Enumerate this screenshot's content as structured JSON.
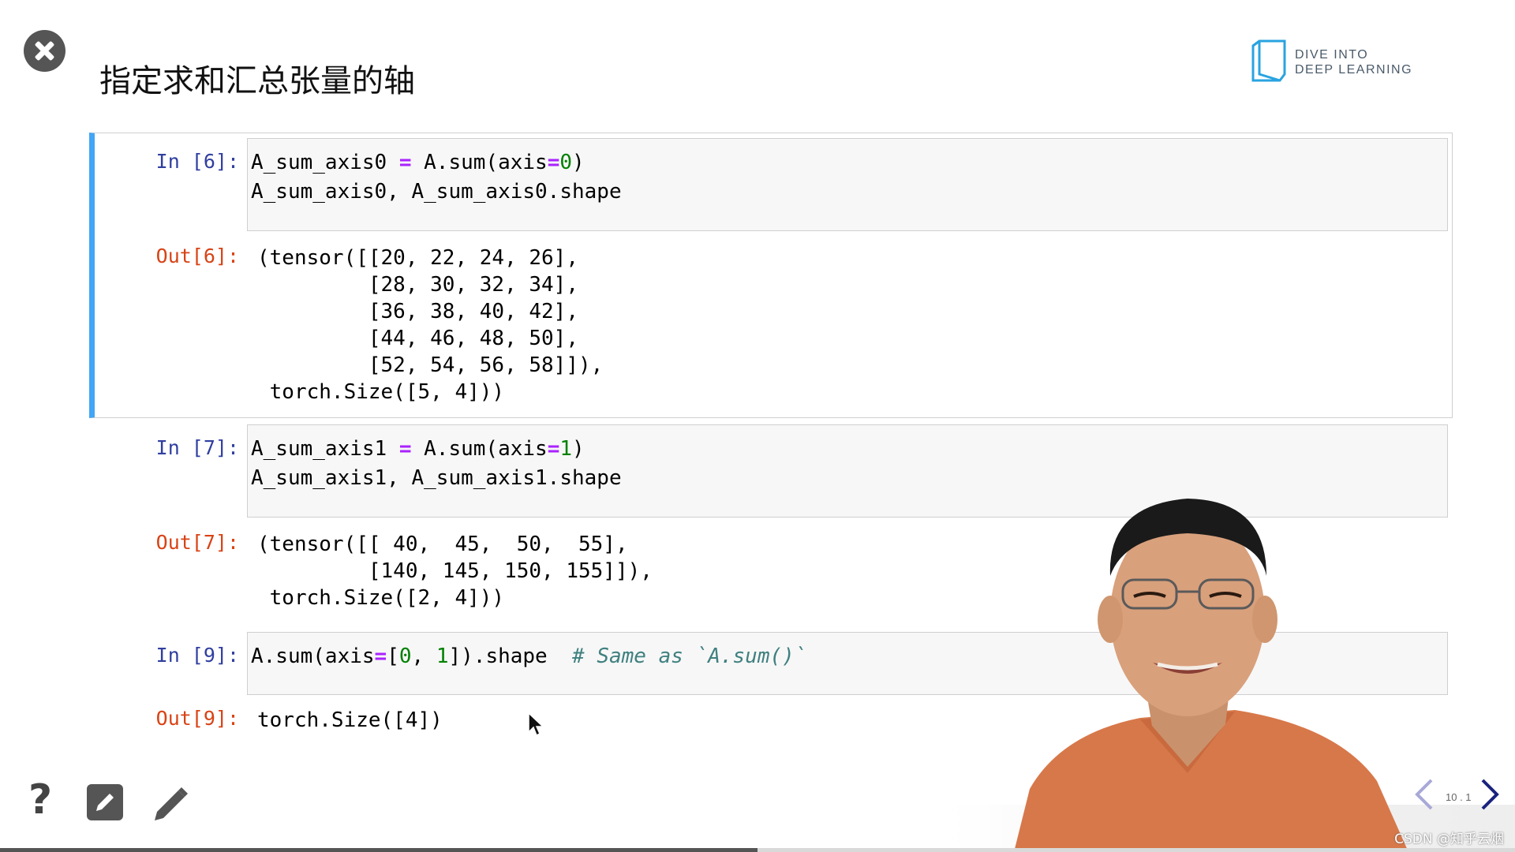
{
  "slide": {
    "title": "指定求和汇总张量的轴",
    "brand_line1": "DIVE INTO",
    "brand_line2": "DEEP LEARNING"
  },
  "cells": [
    {
      "in_prompt": "In [6]:",
      "code_line1_a": "A_sum_axis0 ",
      "code_line1_op": "=",
      "code_line1_b": " A.sum(axis",
      "code_line1_op2": "=",
      "code_line1_num": "0",
      "code_line1_c": ")",
      "code_line2": "A_sum_axis0, A_sum_axis0.shape",
      "out_prompt": "Out[6]:",
      "output": "(tensor([[20, 22, 24, 26],\n         [28, 30, 32, 34],\n         [36, 38, 40, 42],\n         [44, 46, 48, 50],\n         [52, 54, 56, 58]]),\n torch.Size([5, 4]))"
    },
    {
      "in_prompt": "In [7]:",
      "code_line1_a": "A_sum_axis1 ",
      "code_line1_op": "=",
      "code_line1_b": " A.sum(axis",
      "code_line1_op2": "=",
      "code_line1_num": "1",
      "code_line1_c": ")",
      "code_line2": "A_sum_axis1, A_sum_axis1.shape",
      "out_prompt": "Out[7]:",
      "output": "(tensor([[ 40,  45,  50,  55],\n         [140, 145, 150, 155]]),\n torch.Size([2, 4]))"
    },
    {
      "in_prompt": "In [9]:",
      "code_a": "A.sum(axis",
      "code_op": "=",
      "code_b": "[",
      "code_n0": "0",
      "code_c": ", ",
      "code_n1": "1",
      "code_d": "]).shape  ",
      "code_comment": "# Same as `A.sum()`",
      "out_prompt": "Out[9]:",
      "output": "torch.Size([4])"
    }
  ],
  "navigation": {
    "page_number": "10 . 1",
    "progress_fraction": 0.5
  },
  "watermark": "CSDN @知乎云烟",
  "icons": [
    "close-icon",
    "help-icon",
    "note-icon",
    "pencil-icon",
    "chevron-left-icon",
    "chevron-right-icon"
  ]
}
